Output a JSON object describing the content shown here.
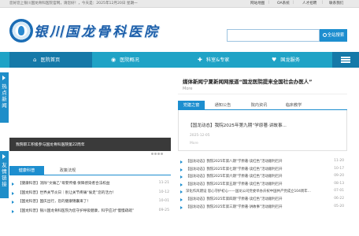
{
  "topbar": {
    "welcome": "您好您上银川国龙骨科医院官网，请您好！，今天是：2025年12月20日 星期一",
    "links": [
      "网站地图",
      "OA系统",
      "人才招聘",
      "联系我们"
    ]
  },
  "header": {
    "logo_text": "银川国龙骨科医院",
    "search_value": "",
    "search_button": "全站搜索"
  },
  "nav": {
    "items": [
      {
        "label": "医院首页",
        "icon": "home-icon"
      },
      {
        "label": "医院概况",
        "icon": "info-icon"
      },
      {
        "label": "科室&专家",
        "icon": "doctor-icon"
      },
      {
        "label": "国龙服务",
        "icon": "service-icon"
      }
    ]
  },
  "side": {
    "tab1": [
      "热",
      "点",
      "新",
      "闻"
    ],
    "tab2": [
      "友",
      "情",
      "链",
      "接"
    ]
  },
  "banner": {
    "caption": "我院职工积极参与国龙骨科医院第22周年"
  },
  "featured": {
    "title": "媒体新闻宁夏新闻网报道“国龙医院提来全国社会办医人”",
    "more": "More"
  },
  "news_tabs": [
    "党建之窗",
    "通知公告",
    "院内资讯",
    "临床教学"
  ],
  "news_highlight": {
    "title": "【国龙动态】我院2025年第九期“学原著·讲故事...",
    "date": "2025-12-05",
    "more": "More"
  },
  "news_list": [
    {
      "title": "【国龙动态】我院2025年第八期“学原著·读红色”活动顺利召开",
      "date": "11-20"
    },
    {
      "title": "【国龙动态】我院2025年第七期“学原著·读红色”活动顺利召开",
      "date": "10-17"
    },
    {
      "title": "【国龙动态】我院2025年第六期“学原著·读红色”活动顺利召开",
      "date": "09-20"
    },
    {
      "title": "【国龙动态】我院2025年第五期“学原著·读红色”活动顺利召开",
      "date": "08-13"
    },
    {
      "title": "深化作风建设 思心守护初心——国龙公司党委举办庆祝中国共产党成立104周年...",
      "date": "07-01"
    },
    {
      "title": "【国龙动态】我院2025年第四期“学原著·读红色”活动顺利召开",
      "date": "06-22"
    },
    {
      "title": "【国龙动态】我院2025年第三期“学原著·讲故事”活动顺利召开",
      "date": "05-20"
    }
  ],
  "left_tabs": [
    "健康科普",
    "政策法规"
  ],
  "left_list": [
    {
      "title": "【健康科普】消除“文痛乙”母婴传播 保障感染者合法权益",
      "date": "11-21"
    },
    {
      "title": "【国龙科普】世界关节炎日｜别让关节疼痛“偷走”您的活力！",
      "date": "10-12"
    },
    {
      "title": "【国龙科普】国庆出行，您的健康锦囊来了！",
      "date": "10-01"
    },
    {
      "title": "【国龙科普】银川国龙骨科医院为您守护呼吸健康，科学应对“慢慢疏疏”",
      "date": "09-25"
    }
  ]
}
